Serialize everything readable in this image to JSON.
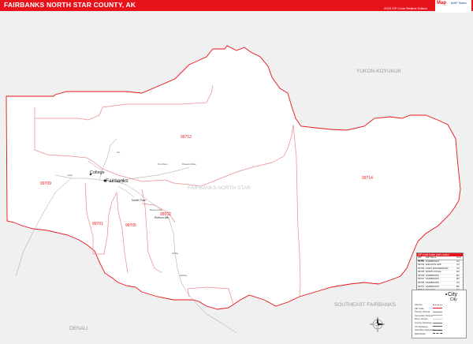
{
  "header": {
    "title": "FAIRBANKS NORTH STAR COUNTY, AK",
    "edition": "2020 ZIP Code Redline Edition",
    "logo_text": "Map",
    "logo_sub": "MAP Sales"
  },
  "regions": {
    "north": "YUKON-KOYUKUK",
    "southeast": "SOUTHEAST FAIRBANKS",
    "southwest": "DENALI",
    "county": "FAIRBANKS NORTH STAR"
  },
  "zips": {
    "z99712": "99712",
    "z99714": "99714",
    "z99709": "99709",
    "z99701": "99701",
    "z99705": "99705",
    "z99702": "99702"
  },
  "cities": {
    "college": "College",
    "fairbanks": "Fairbanks",
    "north_pole": "North Pole",
    "eielson": "Eielson Afb",
    "ester": "Ester",
    "fox": "Fox",
    "two_rivers": "Two Rivers",
    "pleasant_valley": "Pleasant Valley",
    "moose_creek": "Moose Creek",
    "salcha": "Salcha",
    "harding": "Harding"
  },
  "zip_table": {
    "title": "ZIP Code Index and Locator",
    "columns": [
      "ZIP Code",
      "ZIP Name",
      "Grid"
    ],
    "rows": [
      [
        "99701",
        "FAIRBANKS",
        "C2"
      ],
      [
        "99702",
        "EIELSON AFB",
        "C3"
      ],
      [
        "99703",
        "FORT WAINWRIGHT",
        "C3"
      ],
      [
        "99705",
        "NORTH POLE",
        "D3"
      ],
      [
        "99706",
        "FAIRBANKS",
        "B2"
      ],
      [
        "99707",
        "FAIRBANKS",
        "B3"
      ],
      [
        "99709",
        "FAIRBANKS",
        "C2"
      ],
      [
        "99712",
        "FAIRBANKS",
        "B2"
      ],
      [
        "99714",
        "SALCHA",
        "E3"
      ],
      [
        "99775",
        "FAIRBANKS",
        "C2"
      ]
    ]
  },
  "legend": {
    "city_large": "City",
    "city_small": "City",
    "items": [
      "Airports",
      "ZIP Code",
      "Primary Streets",
      "Secondary Streets",
      "Minor Streets",
      "County Highways",
      "US Highways",
      "Interstate Highways",
      "Rail Roads"
    ]
  },
  "colors": {
    "brand_red": "#e8121b",
    "boundary": "#e8121b",
    "county_fill": "#ffffff",
    "outside_fill": "#f0f0f0"
  }
}
